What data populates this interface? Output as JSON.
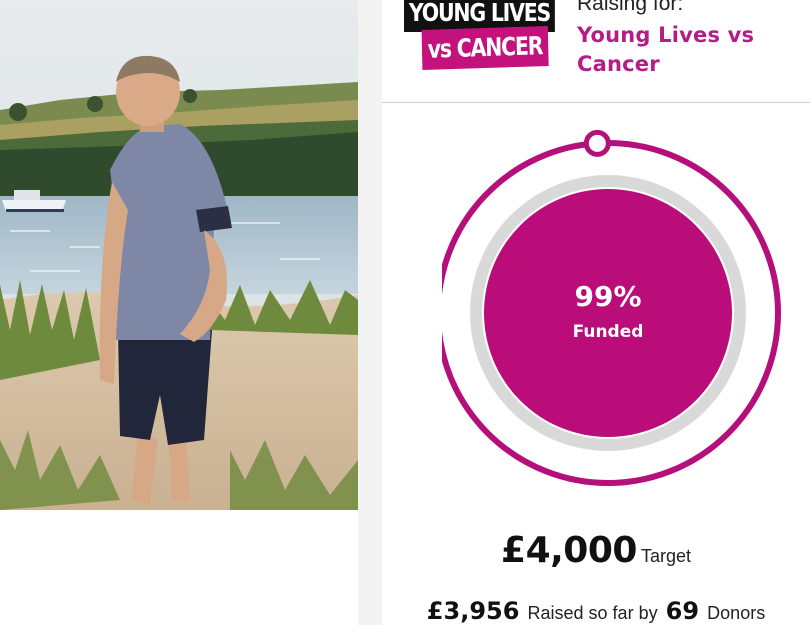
{
  "photo": {
    "description_icon": "fundraiser-photo"
  },
  "charity": {
    "logo_line1": "YOUNG LIVES",
    "logo_line2": "vs CANCER",
    "raising_label": "Raising for:",
    "name": "Young Lives vs Cancer"
  },
  "progress": {
    "fraction": 0.99,
    "percent_text": "99%",
    "label": "Funded"
  },
  "target": {
    "amount": "£4,000",
    "label": "Target"
  },
  "raised": {
    "amount": "£3,956",
    "text": "Raised so far by",
    "donor_count": "69",
    "donors_label": "Donors"
  },
  "colors": {
    "brand": "#b51d86",
    "ring": "#b40f7b",
    "inner_fill": "#bb0d7a",
    "track": "#d9d9d9"
  }
}
